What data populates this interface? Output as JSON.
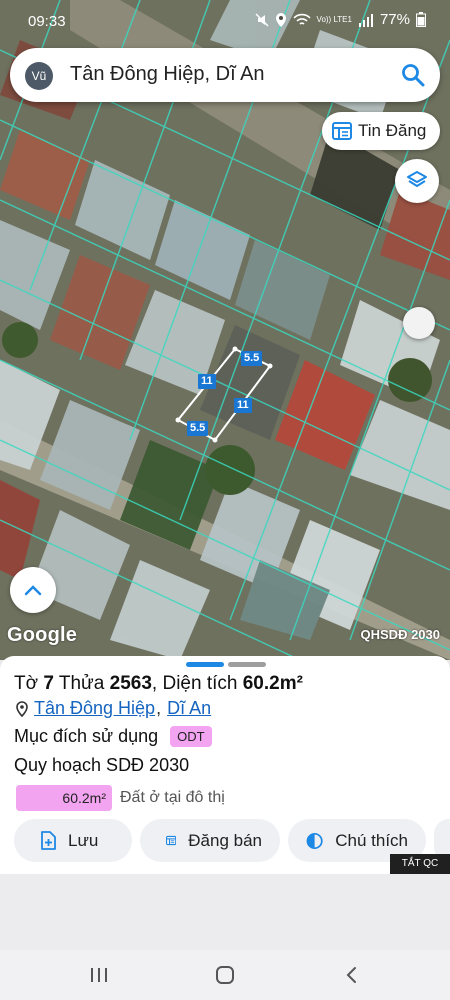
{
  "status_bar": {
    "time": "09:33",
    "network": "Vo)) LTE1",
    "battery": "77%"
  },
  "search": {
    "avatar_initials": "Vũ",
    "query": "Tân Đông Hiệp, Dĩ An",
    "icon": "search-icon"
  },
  "map": {
    "tin_dang_label": "Tin Đăng",
    "google_label": "Google",
    "layer_label": "QHSDĐ 2030",
    "dimensions": {
      "top": "5.5",
      "bottom": "5.5",
      "left": "11",
      "right": "11"
    }
  },
  "parcel": {
    "to_label": "Tờ",
    "to_number": "7",
    "thua_label": "Thửa",
    "thua_number": "2563",
    "area_label": "Diện tích",
    "area_value": "60.2m²",
    "ward": "Tân Đông Hiệp",
    "city": "Dĩ An",
    "purpose_label": "Mục đích sử dụng",
    "purpose_code": "ODT",
    "plan_title": "Quy hoạch SDĐ 2030",
    "plan_area": "60.2m²",
    "plan_use": "Đất ở tại đô thị",
    "plan_fill_fraction": 1.0
  },
  "actions": {
    "save": "Lưu",
    "sell": "Đăng bán",
    "legend": "Chú thích"
  },
  "ad": {
    "close_label": "TẮT QC"
  },
  "colors": {
    "accent": "#1e88e5",
    "odt": "#f3a4f0",
    "parcel_outline": "#39d9c0"
  }
}
